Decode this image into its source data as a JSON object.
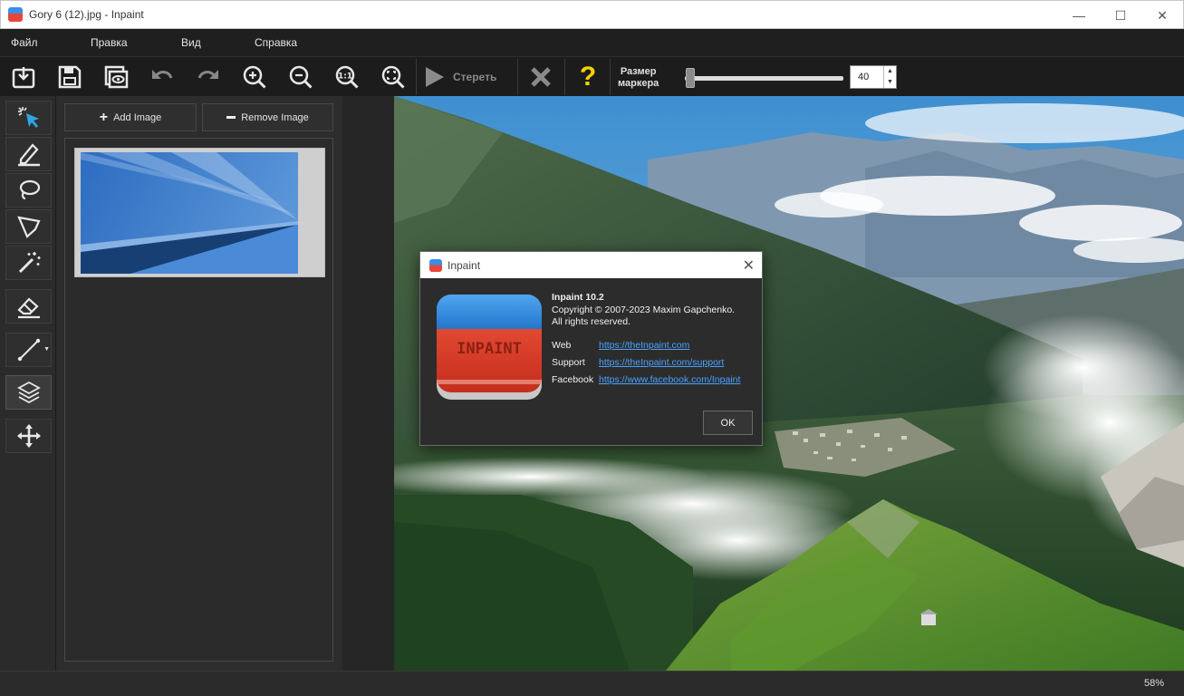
{
  "window": {
    "title": "Gory 6 (12).jpg - Inpaint",
    "controls": {
      "minimize": "—",
      "maximize": "☐",
      "close": "✕"
    }
  },
  "menu": [
    "Файл",
    "Правка",
    "Вид",
    "Справка"
  ],
  "toolbar": {
    "open_icon": "open-icon",
    "save_icon": "save-icon",
    "preview_icon": "preview-icon",
    "undo_icon": "undo-icon",
    "redo_icon": "redo-icon",
    "zoom_in_icon": "zoom-in-icon",
    "zoom_out_icon": "zoom-out-icon",
    "actual_size_icon": "actual-size-icon",
    "fit_icon": "fit-window-icon",
    "erase_label": "Стереть",
    "cancel_icon": "cancel-icon",
    "help_label": "?",
    "marker_label_line1": "Размер",
    "marker_label_line2": "маркера",
    "marker_size": "40",
    "marker_size_fraction": 0.02
  },
  "tools": [
    "select-icon",
    "marker-icon",
    "lasso-icon",
    "polygon-lasso-icon",
    "magic-wand-icon",
    "eraser-icon",
    "line-icon",
    "layers-icon",
    "move-icon"
  ],
  "panel": {
    "add_label": "Add Image",
    "remove_label": "Remove Image"
  },
  "status": {
    "zoom": "58%"
  },
  "dialog": {
    "title": "Inpaint",
    "product": "Inpaint 10.2",
    "copyright": "Copyright © 2007-2023 Maxim Gapchenko.",
    "rights": "All rights reserved.",
    "logo_text": "INPAINT",
    "web_label": "Web",
    "web_url": "https://theInpaint.com",
    "support_label": "Support",
    "support_url": "https://theInpaint.com/support",
    "facebook_label": "Facebook",
    "facebook_url": "https://www.facebook.com/Inpaint",
    "ok_label": "OK"
  },
  "colors": {
    "accent_blue": "#3a8ee8",
    "accent_red": "#e8463a",
    "link": "#4aa3ff",
    "help": "#f5d400"
  }
}
